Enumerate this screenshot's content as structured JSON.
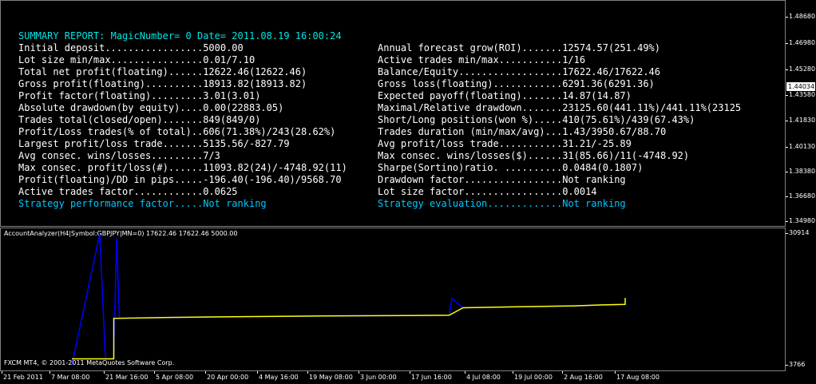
{
  "main_chart": {
    "price_scale": [
      "1.48680",
      "1.46980",
      "1.45280",
      "1.43580",
      "1.41830",
      "1.40130",
      "1.38380",
      "1.36680",
      "1.34980"
    ],
    "current_price": "1.44034"
  },
  "report": {
    "title": "SUMMARY REPORT: MagicNumber= 0 Date= 2011.08.19 16:00:24",
    "left": [
      {
        "label": "Initial deposit.................",
        "value": "5000.00"
      },
      {
        "label": "Lot size min/max................",
        "value": "0.01/7.10"
      },
      {
        "label": "Total net profit(floating)......",
        "value": "12622.46(12622.46)"
      },
      {
        "label": "Gross profit(floating)..........",
        "value": "18913.82(18913.82)"
      },
      {
        "label": "Profit factor(floating).........",
        "value": "3.01(3.01)"
      },
      {
        "label": "Absolute drawdown(by equity)....",
        "value": "0.00(22883.05)"
      },
      {
        "label": "Trades total(closed/open).......",
        "value": "849(849/0)"
      },
      {
        "label": "Profit/Loss trades(% of total)..",
        "value": "606(71.38%)/243(28.62%)"
      },
      {
        "label": "Largest profit/loss trade.......",
        "value": "5135.56/-827.79"
      },
      {
        "label": "Avg consec. wins/losses.........",
        "value": "7/3"
      },
      {
        "label": "Max consec. profit/loss(#)......",
        "value": "11093.82(24)/-4748.92(11)"
      },
      {
        "label": "Profit(floating)/DD in pips.....",
        "value": "-196.40(-196.40)/9568.70"
      },
      {
        "label": "Active trades factor............",
        "value": "0.0625"
      },
      {
        "label": "Strategy performance factor.....",
        "value": "Not ranking"
      }
    ],
    "right": [
      {
        "label": "Annual forecast grow(ROI).......",
        "value": "12574.57(251.49%)"
      },
      {
        "label": "Active trades min/max...........",
        "value": "1/16"
      },
      {
        "label": "Balance/Equity..................",
        "value": "17622.46/17622.46"
      },
      {
        "label": "Gross loss(floating)............",
        "value": "6291.36(6291.36)"
      },
      {
        "label": "Expected payoff(floating).......",
        "value": "14.87(14.87)"
      },
      {
        "label": "Maximal/Relative drawdown.......",
        "value": "23125.60(441.11%)/441.11%(23125"
      },
      {
        "label": "Short/Long positions(won %).....",
        "value": "410(75.61%)/439(67.43%)"
      },
      {
        "label": "Trades duration (min/max/avg)...",
        "value": "1.43/3950.67/88.70"
      },
      {
        "label": "Avg profit/loss trade...........",
        "value": "31.21/-25.89"
      },
      {
        "label": "Max consec. wins/losses($)......",
        "value": "31(85.66)/11(-4748.92)"
      },
      {
        "label": "Sharpe(Sortino)ratio. ..........",
        "value": "0.0484(0.1807)"
      },
      {
        "label": "Drawdown factor.................",
        "value": "Not ranking"
      },
      {
        "label": "Lot size factor.................",
        "value": "0.0014"
      },
      {
        "label": "Strategy evaluation.............",
        "value": "Not ranking"
      }
    ]
  },
  "sub_chart": {
    "title": "AccountAnalyzer(H4|Symbol:GBPJPY|MN=0) 17622.46 17622.46 5000.00",
    "scale": [
      "30914",
      "3766"
    ],
    "copyright": "FXCM MT4, © 2001-2011 MetaQuotes Software Corp."
  },
  "time_axis": [
    "21 Feb 2011",
    "7 Mar 08:00",
    "21 Mar 16:00",
    "5 Apr 08:00",
    "20 Apr 00:00",
    "4 May 16:00",
    "19 May 08:00",
    "3 Jun 00:00",
    "17 Jun 16:00",
    "4 Jul 08:00",
    "19 Jul 00:00",
    "2 Aug 16:00",
    "17 Aug 08:00"
  ],
  "colors": {
    "report_title": "#00e5e5",
    "report_cyan": "#00c8ff",
    "balance_line": "#ffff00",
    "equity_line": "#0000ff",
    "background": "#000000"
  },
  "chart_data": {
    "type": "line",
    "title": "AccountAnalyzer(H4|Symbol:GBPJPY|MN=0) 17622.46 17622.46 5000.00",
    "ylim": [
      3766,
      30914
    ],
    "series": [
      {
        "name": "17622.46",
        "values": [
          [
            0,
            5000
          ],
          [
            1.5,
            5000
          ],
          [
            1.5,
            13400
          ],
          [
            3.5,
            13600
          ],
          [
            5,
            13700
          ],
          [
            7,
            13800
          ],
          [
            9,
            13900
          ],
          [
            12,
            14000
          ],
          [
            13.5,
            14050
          ],
          [
            14,
            15600
          ],
          [
            16,
            15800
          ],
          [
            18,
            16000
          ],
          [
            19,
            16200
          ],
          [
            19.8,
            16300
          ],
          [
            19.8,
            17622.46
          ]
        ]
      },
      {
        "name": "17622.46",
        "values": [
          [
            0,
            3766
          ],
          [
            1,
            30914
          ],
          [
            1.2,
            5000
          ],
          [
            1.5,
            5000
          ],
          [
            1.6,
            30000
          ],
          [
            1.7,
            13400
          ],
          [
            3.5,
            13600
          ],
          [
            5,
            13700
          ],
          [
            7,
            13800
          ],
          [
            9,
            13900
          ],
          [
            12,
            14000
          ],
          [
            13.5,
            14050
          ],
          [
            13.6,
            17500
          ],
          [
            14,
            15600
          ],
          [
            16,
            15800
          ],
          [
            18,
            16000
          ],
          [
            19,
            16200
          ],
          [
            19.8,
            16300
          ]
        ]
      }
    ],
    "x_tick_labels": [
      "21 Feb 2011",
      "7 Mar 08:00",
      "21 Mar 16:00",
      "5 Apr 08:00",
      "20 Apr 00:00",
      "4 May 16:00",
      "19 May 08:00",
      "3 Jun 00:00",
      "17 Jun 16:00",
      "4 Jul 08:00",
      "19 Jul 00:00",
      "2 Aug 16:00",
      "17 Aug 08:00"
    ]
  }
}
